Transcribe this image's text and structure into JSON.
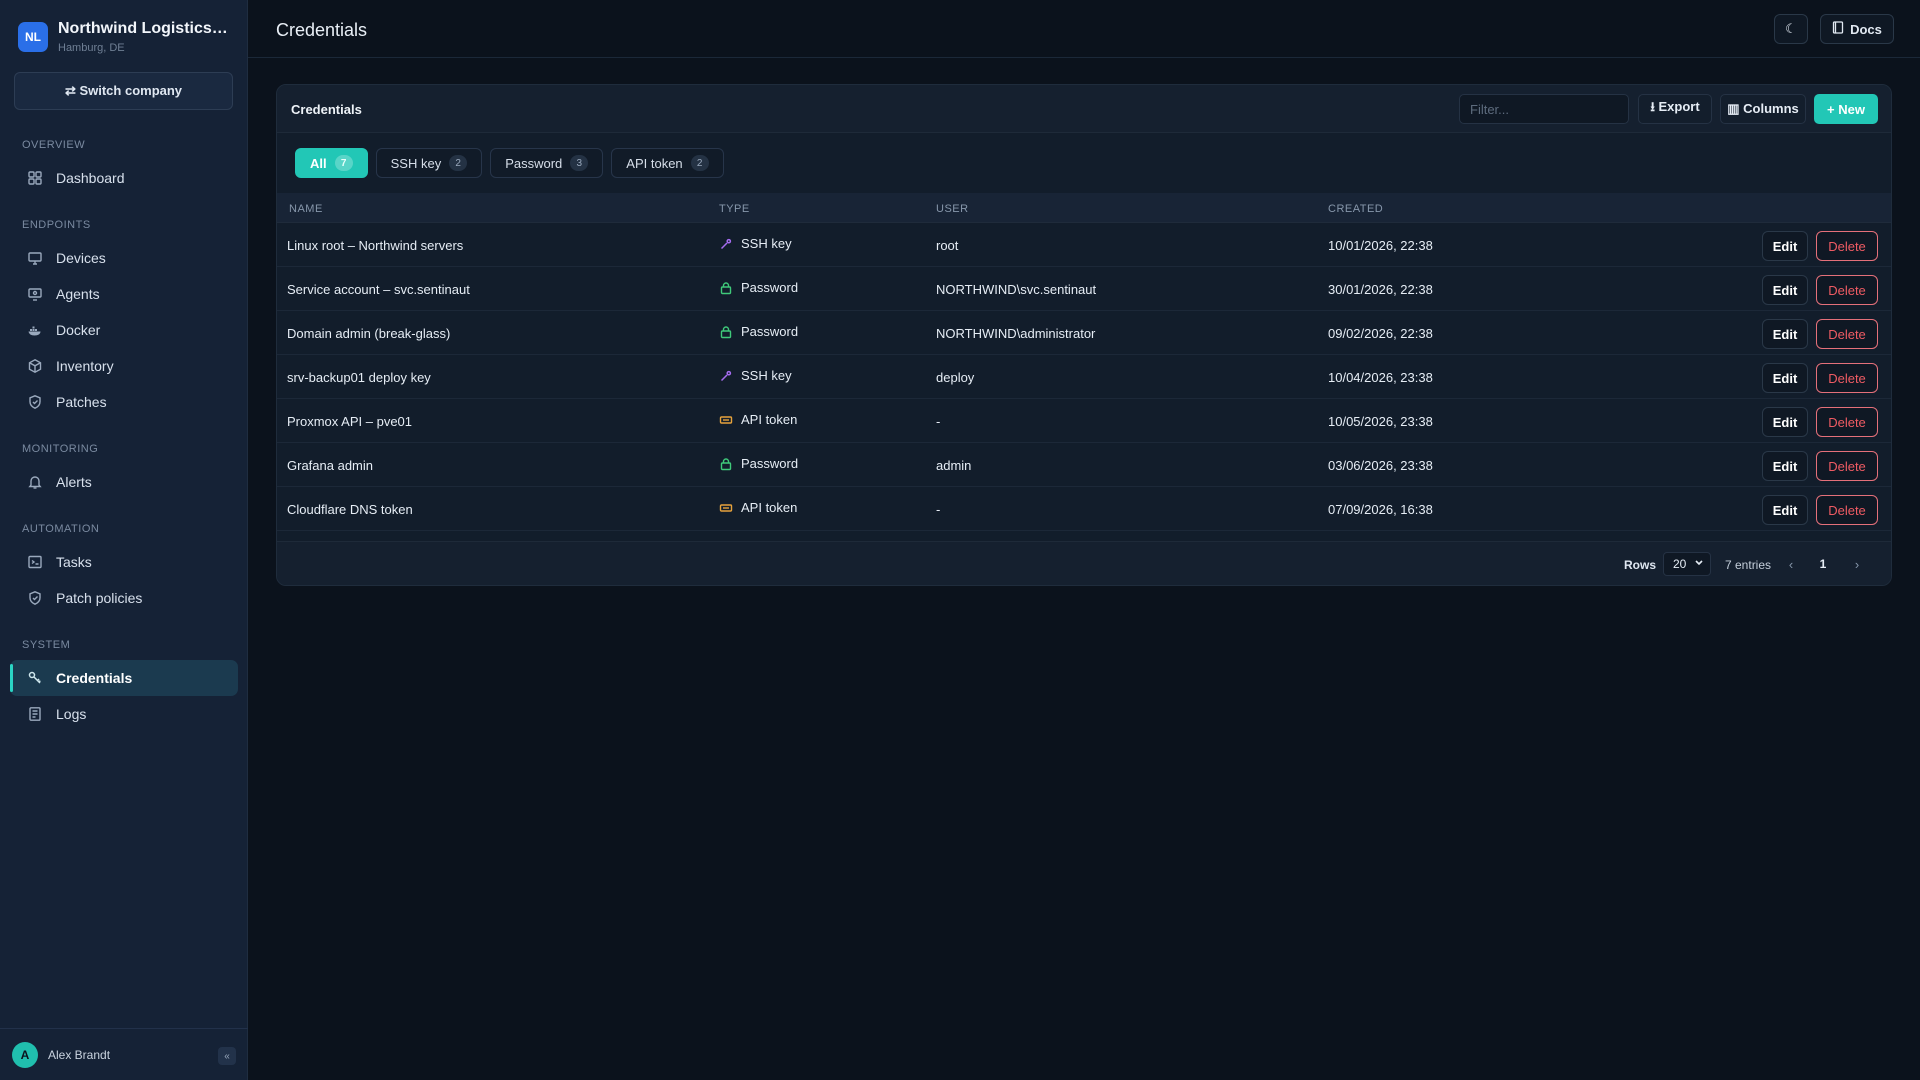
{
  "company": {
    "initials": "NL",
    "name": "Northwind Logistics ...",
    "location": "Hamburg, DE"
  },
  "switch_company_label": "⇄ Switch company",
  "nav": {
    "sections": [
      {
        "label": "OVERVIEW",
        "items": [
          {
            "label": "Dashboard",
            "icon": "grid-icon"
          }
        ]
      },
      {
        "label": "ENDPOINTS",
        "items": [
          {
            "label": "Devices",
            "icon": "monitor-icon"
          },
          {
            "label": "Agents",
            "icon": "agent-icon"
          },
          {
            "label": "Docker",
            "icon": "docker-icon"
          },
          {
            "label": "Inventory",
            "icon": "box-icon"
          },
          {
            "label": "Patches",
            "icon": "shield-icon"
          }
        ]
      },
      {
        "label": "MONITORING",
        "items": [
          {
            "label": "Alerts",
            "icon": "bell-icon"
          }
        ]
      },
      {
        "label": "AUTOMATION",
        "items": [
          {
            "label": "Tasks",
            "icon": "terminal-icon"
          },
          {
            "label": "Patch policies",
            "icon": "shield-check-icon"
          }
        ]
      },
      {
        "label": "SYSTEM",
        "items": [
          {
            "label": "Credentials",
            "icon": "key-icon",
            "active": true
          },
          {
            "label": "Logs",
            "icon": "log-icon"
          }
        ]
      }
    ]
  },
  "user": {
    "initial": "A",
    "name": "Alex Brandt",
    "collapse_label": "«"
  },
  "header": {
    "title": "Credentials",
    "theme_icon": "☾",
    "docs_label": "Docs"
  },
  "card": {
    "title": "Credentials",
    "filter_placeholder": "Filter...",
    "export_label": "⭳ Export",
    "columns_label": "▥ Columns",
    "new_label": "+ New"
  },
  "tabs": [
    {
      "label": "All",
      "count": "7",
      "active": true
    },
    {
      "label": "SSH key",
      "count": "2"
    },
    {
      "label": "Password",
      "count": "3"
    },
    {
      "label": "API token",
      "count": "2"
    }
  ],
  "columns": {
    "name": "NAME",
    "type": "TYPE",
    "user": "USER",
    "created": "CREATED"
  },
  "rows": [
    {
      "name": "Linux root – Northwind servers",
      "type": "SSH key",
      "type_icon": "key-icon",
      "user": "root",
      "created": "10/01/2026, 22:38"
    },
    {
      "name": "Service account – svc.sentinaut",
      "type": "Password",
      "type_icon": "lock-icon",
      "user": "NORTHWIND\\svc.sentinaut",
      "created": "30/01/2026, 22:38"
    },
    {
      "name": "Domain admin (break-glass)",
      "type": "Password",
      "type_icon": "lock-icon",
      "user": "NORTHWIND\\administrator",
      "created": "09/02/2026, 22:38"
    },
    {
      "name": "srv-backup01 deploy key",
      "type": "SSH key",
      "type_icon": "key-icon",
      "user": "deploy",
      "created": "10/04/2026, 23:38"
    },
    {
      "name": "Proxmox API – pve01",
      "type": "API token",
      "type_icon": "token-icon",
      "user": "-",
      "created": "10/05/2026, 23:38"
    },
    {
      "name": "Grafana admin",
      "type": "Password",
      "type_icon": "lock-icon",
      "user": "admin",
      "created": "03/06/2026, 23:38"
    },
    {
      "name": "Cloudflare DNS token",
      "type": "API token",
      "type_icon": "token-icon",
      "user": "-",
      "created": "07/09/2026, 16:38"
    }
  ],
  "row_actions": {
    "edit": "Edit",
    "delete": "Delete"
  },
  "footer": {
    "rows_label": "Rows",
    "rows_value": "20",
    "entries": "7 entries",
    "prev": "‹",
    "page": "1",
    "next": "›"
  },
  "colors": {
    "accent": "#22c7b6",
    "key": "#a56cf0",
    "lock": "#3fc97a",
    "token": "#e6a23c",
    "danger": "#ef5b63"
  }
}
